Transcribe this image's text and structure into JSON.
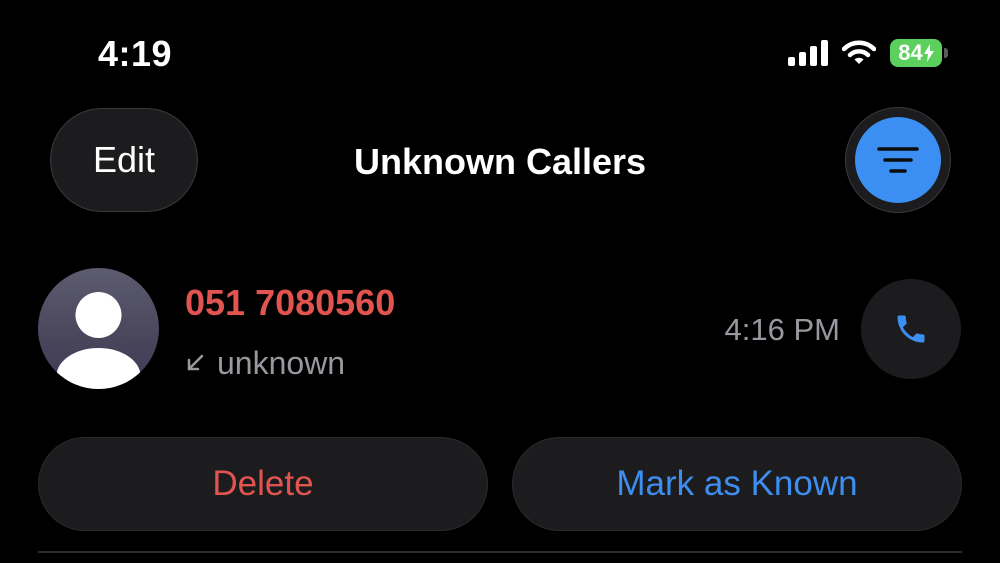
{
  "status_bar": {
    "time": "4:19",
    "battery_level": "84",
    "battery_charging": true,
    "signal_bars": 4,
    "wifi_icon": "wifi-icon",
    "battery_color": "#5bd05d"
  },
  "header": {
    "edit_label": "Edit",
    "title": "Unknown Callers",
    "filter_icon": "filter-icon",
    "filter_active_color": "#3b8ff2"
  },
  "call": {
    "number": "051 7080560",
    "direction_icon": "incoming-arrow-icon",
    "label": "unknown",
    "time": "4:16 PM",
    "number_color": "#e2544f",
    "call_icon": "phone-icon"
  },
  "actions": {
    "delete_label": "Delete",
    "mark_known_label": "Mark as Known",
    "delete_color": "#e2544f",
    "mark_known_color": "#3d8ef0"
  }
}
